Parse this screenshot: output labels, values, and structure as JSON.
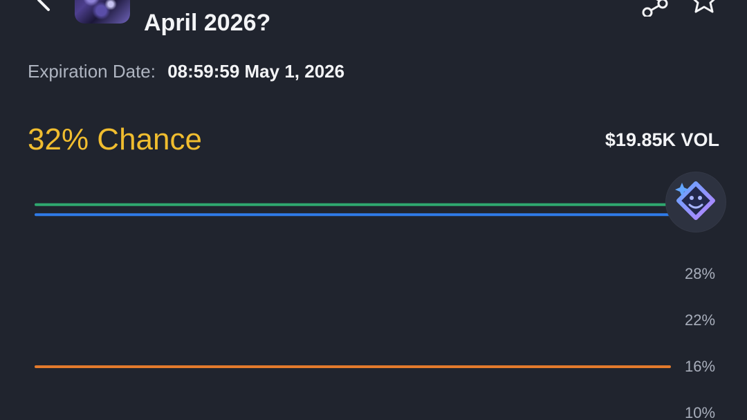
{
  "header": {
    "title": "April 2026?",
    "back_icon": "chevron-left-icon",
    "share_icon": "share-icon",
    "star_icon": "star-icon"
  },
  "market": {
    "expiration_label": "Expiration Date:",
    "expiration_value": "08:59:59 May 1, 2026",
    "chance_text": "32% Chance",
    "volume_text": "$19.85K VOL"
  },
  "assistant": {
    "icon": "ai-assistant-icon"
  },
  "colors": {
    "background": "#20242e",
    "accent": "#f0bd2f",
    "text_primary": "#f3f4f6",
    "text_secondary": "#aeb4c0",
    "green_series": "#2fa86f",
    "blue_series": "#2f7be8",
    "orange_series": "#e37a2c",
    "assistant_bg": "#2d3240"
  },
  "chart_data": {
    "type": "line",
    "y_ticks": [
      "28%",
      "22%",
      "16%",
      "10%"
    ],
    "y_tick_values": [
      28,
      22,
      16,
      10
    ],
    "ylim": [
      9,
      41
    ],
    "series": [
      {
        "color": "#2fa86f",
        "values": [
          36.9,
          36.9
        ]
      },
      {
        "color": "#2f7be8",
        "values": [
          35.6,
          35.6
        ]
      },
      {
        "color": "#e37a2c",
        "values": [
          15.9,
          15.9
        ]
      }
    ]
  }
}
